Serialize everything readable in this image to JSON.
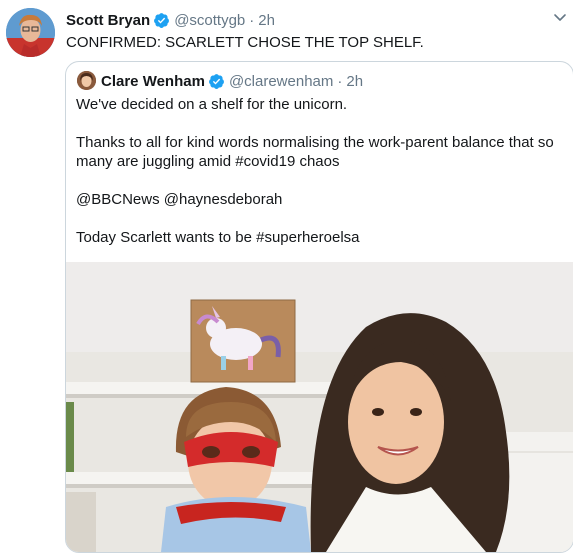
{
  "tweet": {
    "author_name": "Scott Bryan",
    "author_handle": "@scottygb",
    "separator": "·",
    "time": "2h",
    "text": "CONFIRMED: SCARLETT CHOSE THE TOP SHELF.",
    "verified": true,
    "icons": {
      "verified": "verified-badge-icon",
      "menu": "chevron-down-icon"
    }
  },
  "quoted_tweet": {
    "author_name": "Clare Wenham",
    "author_handle": "@clarewenham",
    "separator": "·",
    "time": "2h",
    "verified": true,
    "lines": [
      "We've decided on a shelf for the unicorn.",
      "Thanks to all for kind words normalising the work-parent balance that so",
      "many are juggling amid #covid19 chaos",
      "@BBCNews @haynesdeborah",
      "Today Scarlett wants to be #superheroelsa"
    ]
  },
  "colors": {
    "text_primary": "#14171a",
    "text_secondary": "#657786",
    "verified_blue": "#1da1f2",
    "border": "#ccd6dd"
  }
}
